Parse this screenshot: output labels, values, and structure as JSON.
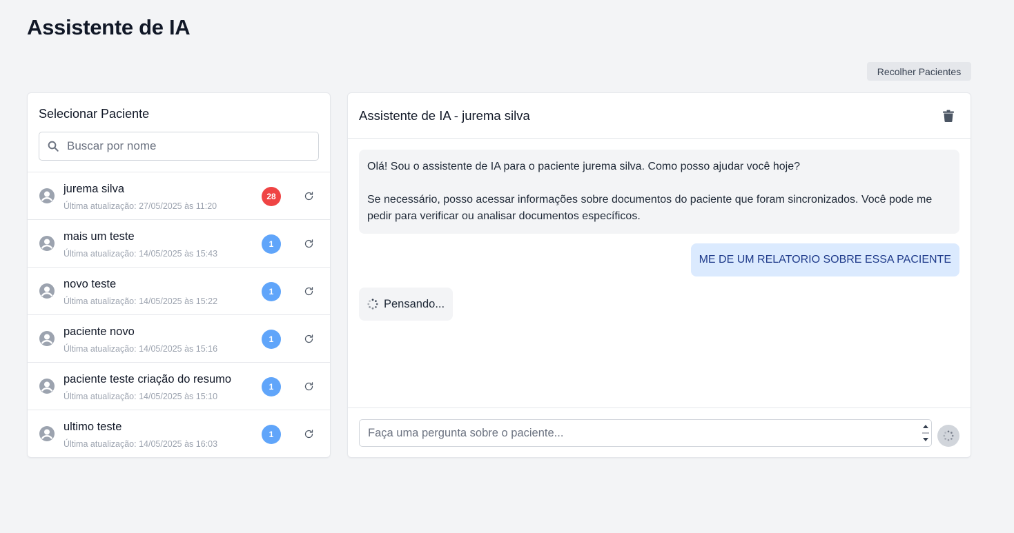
{
  "page": {
    "title": "Assistente de IA"
  },
  "toolbar": {
    "collapse_label": "Recolher Pacientes"
  },
  "patients": {
    "title": "Selecionar Paciente",
    "search_placeholder": "Buscar por nome",
    "items": [
      {
        "name": "jurema silva",
        "updated": "Última atualização: 27/05/2025 às 11:20",
        "count": "28",
        "badge_color": "#ef4444"
      },
      {
        "name": "mais um teste",
        "updated": "Última atualização: 14/05/2025 às 15:43",
        "count": "1",
        "badge_color": "#60a5fa"
      },
      {
        "name": "novo teste",
        "updated": "Última atualização: 14/05/2025 às 15:22",
        "count": "1",
        "badge_color": "#60a5fa"
      },
      {
        "name": "paciente novo",
        "updated": "Última atualização: 14/05/2025 às 15:16",
        "count": "1",
        "badge_color": "#60a5fa"
      },
      {
        "name": "paciente teste criação do resumo",
        "updated": "Última atualização: 14/05/2025 às 15:10",
        "count": "1",
        "badge_color": "#60a5fa"
      },
      {
        "name": "ultimo teste",
        "updated": "Última atualização: 14/05/2025 às 16:03",
        "count": "1",
        "badge_color": "#60a5fa"
      }
    ]
  },
  "chat": {
    "title": "Assistente de IA - jurema silva",
    "messages": {
      "assistant_intro_1": "Olá! Sou o assistente de IA para o paciente jurema silva. Como posso ajudar você hoje?",
      "assistant_intro_2": "Se necessário, posso acessar informações sobre documentos do paciente que foram sincronizados. Você pode me pedir para verificar ou analisar documentos específicos.",
      "user_1": "ME DE UM RELATORIO SOBRE ESSA PACIENTE",
      "thinking": "Pensando..."
    },
    "input_placeholder": "Faça uma pergunta sobre o paciente..."
  },
  "icons": {
    "search": "search-icon",
    "avatar": "user-circle-icon",
    "refresh": "refresh-icon",
    "trash": "trash-icon",
    "spinner": "loading-spinner-icon"
  }
}
